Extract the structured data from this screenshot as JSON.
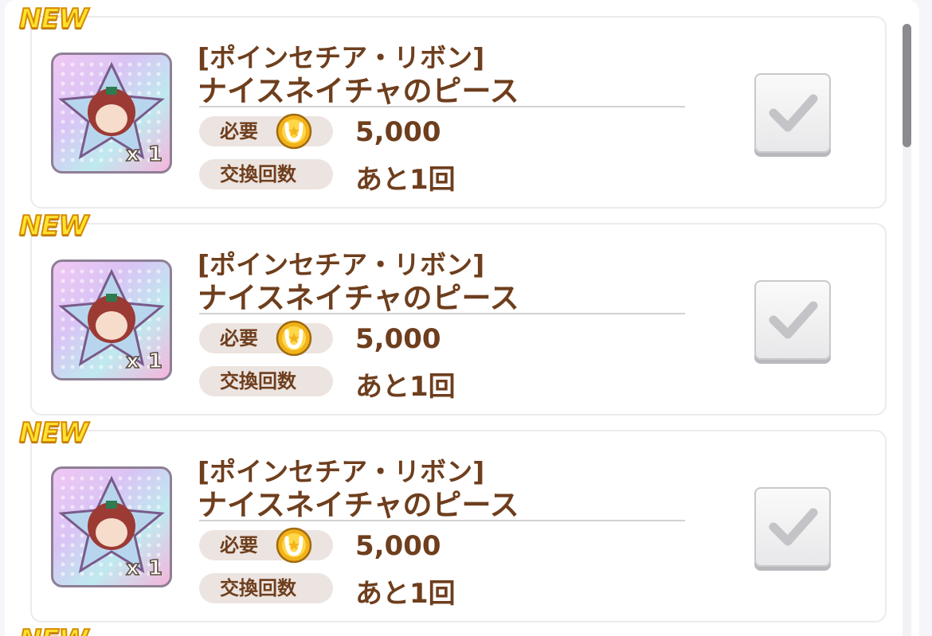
{
  "new_badge": "NEW",
  "items": [
    {
      "subtitle": "[ポインセチア・リボン]",
      "title": "ナイスネイチャのピース",
      "quantity": "x 1",
      "cost_label": "必要",
      "cost_value": "5,000",
      "count_label": "交換回数",
      "count_value": "あと1回",
      "coin_icon": "horseshoe-coin-icon",
      "checked": true
    },
    {
      "subtitle": "[ポインセチア・リボン]",
      "title": "ナイスネイチャのピース",
      "quantity": "x 1",
      "cost_label": "必要",
      "cost_value": "5,000",
      "count_label": "交換回数",
      "count_value": "あと1回",
      "coin_icon": "horseshoe-coin-icon",
      "checked": true
    },
    {
      "subtitle": "[ポインセチア・リボン]",
      "title": "ナイスネイチャのピース",
      "quantity": "x 1",
      "cost_label": "必要",
      "cost_value": "5,000",
      "count_label": "交換回数",
      "count_value": "あと1回",
      "coin_icon": "horseshoe-coin-icon",
      "checked": true
    }
  ],
  "colors": {
    "text_brown": "#6e3e1d",
    "badge_yellow": "#ffe22e",
    "pill_bg": "#ece4e0",
    "card_border": "#ebebef"
  }
}
